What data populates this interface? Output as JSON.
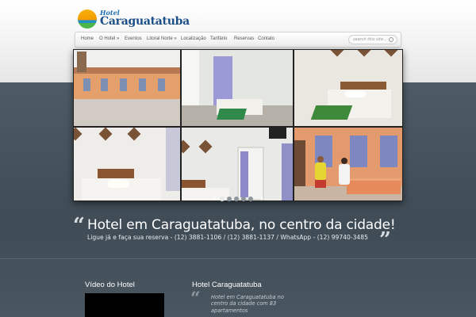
{
  "logo": {
    "line1": "Hotel",
    "line2": "Caraguatatuba"
  },
  "nav": {
    "items": [
      {
        "label": "Home"
      },
      {
        "label": "O Hotel »"
      },
      {
        "label": "Eventos"
      },
      {
        "label": "Litoral Norte »"
      },
      {
        "label": "Localização"
      },
      {
        "label": "Tarifário"
      },
      {
        "label": "Reservas"
      },
      {
        "label": "Contato"
      }
    ],
    "search_placeholder": "search this site..."
  },
  "slider": {
    "prev_label": "‹",
    "next_label": "›",
    "dot_count": 5,
    "active_dot": 1
  },
  "tagline": {
    "open_quote": "“",
    "close_quote": "”",
    "headline": "Hotel em Caraguatatuba, no centro da cidade!",
    "subline": "Ligue já e faça sua reserva - (12) 3881-1106 / (12) 3881-1137 / WhatsApp - (12) 99740-3485"
  },
  "sections": {
    "video_title": "Vídeo do Hotel",
    "hotel_title": "Hotel Caraguatatuba",
    "hotel_quote": "“",
    "hotel_text": "Hotel em Caraguatatuba no centro da cidade com 83 apartamentos"
  },
  "colors": {
    "dark_band": "#46525c",
    "nav_text": "#555555",
    "logo_blue": "#1b4f8a"
  }
}
